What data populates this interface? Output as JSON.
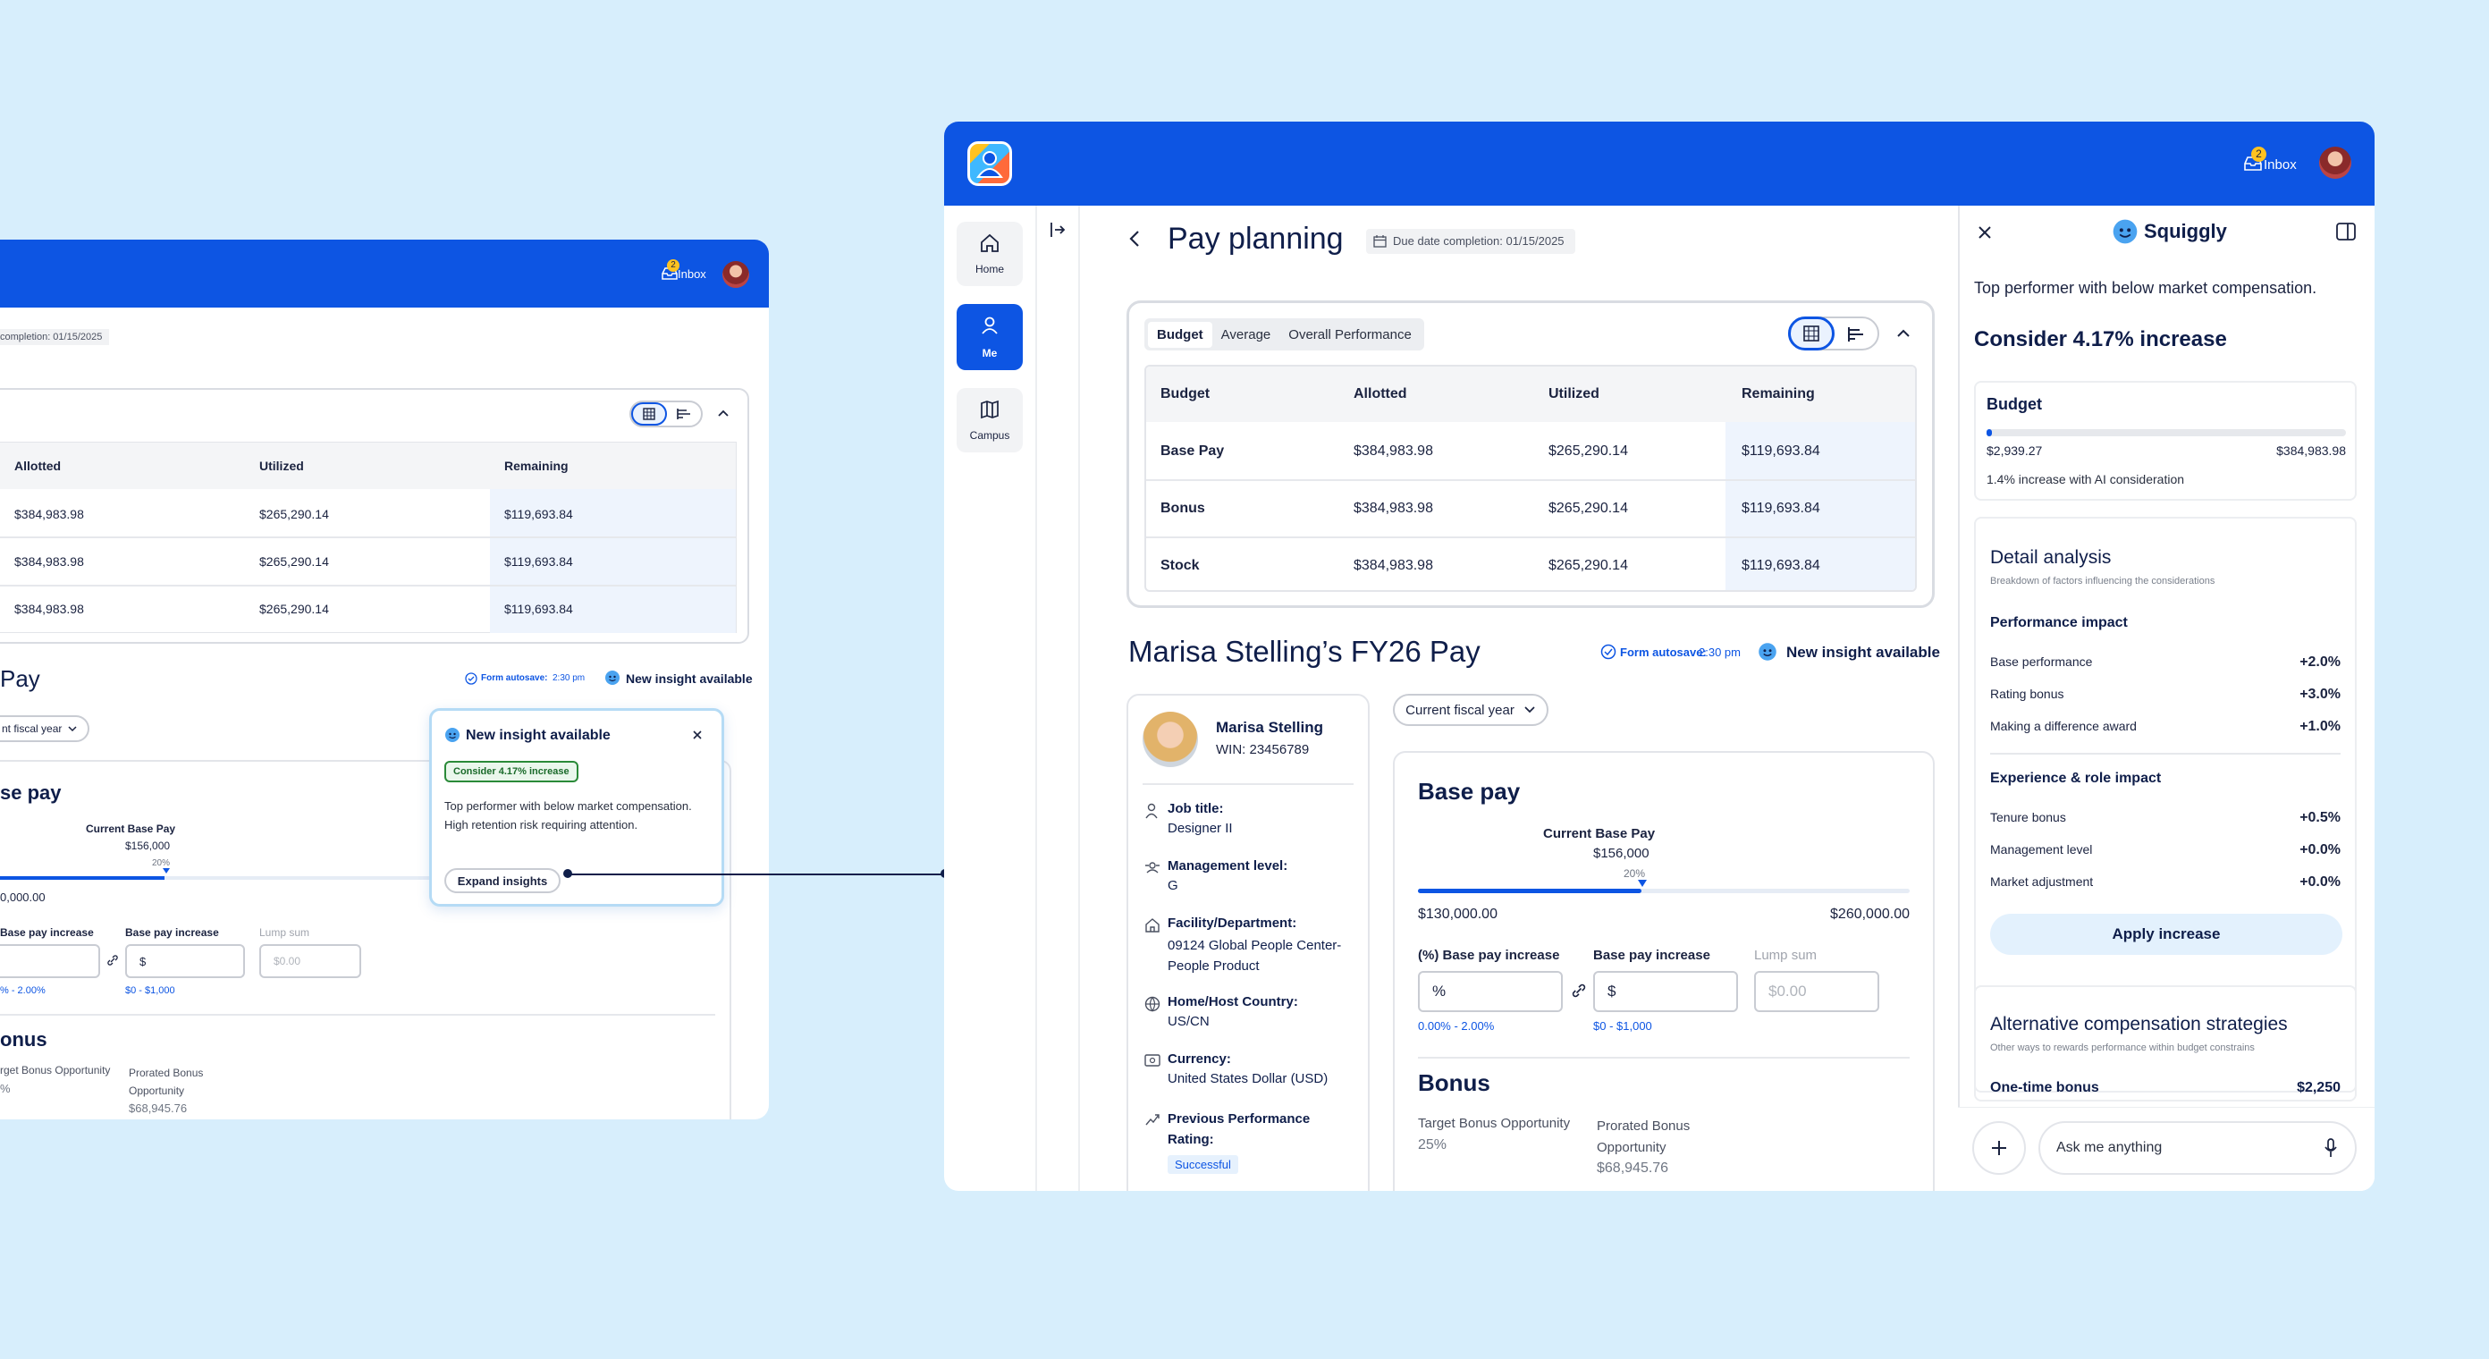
{
  "colors": {
    "brand_blue": "#0d55e3",
    "background": "#d7eefc",
    "navy": "#0f1e4a",
    "success_green": "#1a7a2a",
    "accent_light": "#e6f1fd"
  },
  "header": {
    "inbox_label": "Inbox",
    "inbox_badge": "2"
  },
  "nav": {
    "home": "Home",
    "me": "Me",
    "campus": "Campus"
  },
  "page": {
    "title": "Pay planning",
    "due_date": "Due date completion: 01/15/2025",
    "due_date_cropped": "completion: 01/15/2025"
  },
  "budget": {
    "tabs": [
      "Budget",
      "Average",
      "Overall Performance"
    ],
    "headers": [
      "Budget",
      "Allotted",
      "Utilized",
      "Remaining"
    ],
    "rows": [
      {
        "name": "Base Pay",
        "allotted": "$384,983.98",
        "utilized": "$265,290.14",
        "remaining": "$119,693.84"
      },
      {
        "name": "Bonus",
        "allotted": "$384,983.98",
        "utilized": "$265,290.14",
        "remaining": "$119,693.84"
      },
      {
        "name": "Stock",
        "allotted": "$384,983.98",
        "utilized": "$265,290.14",
        "remaining": "$119,693.84"
      }
    ]
  },
  "employee": {
    "section_title": "Marisa Stelling’s FY26 Pay",
    "section_title_cropped": "Pay",
    "autosave_label": "Form autosave:",
    "autosave_time": "2:30 pm",
    "insight_label": "New insight available",
    "name": "Marisa Stelling",
    "win": "WIN: 23456789",
    "fiscal_select": "Current fiscal year",
    "fiscal_select_cropped": "nt fiscal year",
    "details": [
      {
        "label": "Job title:",
        "value": "Designer II"
      },
      {
        "label": "Management level:",
        "value": "G"
      },
      {
        "label": "Facility/Department:",
        "value": "09124 Global People Center-People Product"
      },
      {
        "label": "Home/Host Country:",
        "value": "US/CN"
      },
      {
        "label": "Currency:",
        "value": "United States Dollar (USD)"
      },
      {
        "label": "Previous Performance Rating:",
        "value": "Successful"
      }
    ]
  },
  "base_pay": {
    "title": "Base pay",
    "title_cropped": "se pay",
    "current_label": "Current Base Pay",
    "current_value": "$156,000",
    "percent": "20%",
    "range_fraction": 0.2,
    "min": "$130,000.00",
    "min_cropped": "0,000.00",
    "max": "$260,000.00",
    "pct_increase_label": "(%) Base pay increase",
    "pct_increase_label_cropped": "Base pay increase",
    "pct_placeholder": "%",
    "pct_hint": "0.00% - 2.00%",
    "pct_hint_cropped": "% - 2.00%",
    "amt_increase_label": "Base pay increase",
    "amt_placeholder": "$",
    "amt_hint": "$0 - $1,000",
    "lump_label": "Lump sum",
    "lump_placeholder": "$0.00"
  },
  "bonus": {
    "title": "Bonus",
    "title_cropped": "onus",
    "target_label": "Target Bonus Opportunity",
    "target_label_cropped": "rget Bonus Opportunity",
    "target_value": "25%",
    "target_value_cropped": "%",
    "prorated_label": "Prorated Bonus Opportunity",
    "prorated_value": "$68,945.76"
  },
  "popover": {
    "title": "New insight available",
    "chip": "Consider 4.17% increase",
    "body": "Top performer with below market compensation. High retention risk requiring attention.",
    "button": "Expand insights"
  },
  "squiggly": {
    "title": "Squiggly",
    "intro": "Top performer with below market compensation.",
    "headline": "Consider 4.17% increase",
    "budget_title": "Budget",
    "budget_min": "$2,939.27",
    "budget_max": "$384,983.98",
    "budget_fraction": 0.014,
    "budget_note": "1.4% increase with AI consideration",
    "detail_title": "Detail analysis",
    "detail_sub": "Breakdown of factors influencing the considerations",
    "perf_title": "Performance impact",
    "perf": [
      {
        "label": "Base performance",
        "value": "+2.0%"
      },
      {
        "label": "Rating bonus",
        "value": "+3.0%"
      },
      {
        "label": "Making a difference award",
        "value": "+1.0%"
      }
    ],
    "exp_title": "Experience & role impact",
    "exp": [
      {
        "label": "Tenure bonus",
        "value": "+0.5%"
      },
      {
        "label": "Management level",
        "value": "+0.0%"
      },
      {
        "label": "Market adjustment",
        "value": "+0.0%"
      }
    ],
    "apply_button": "Apply increase",
    "alt_title": "Alternative compensation strategies",
    "alt_sub": "Other ways to rewards performance within budget constrains",
    "alt_item_label": "One-time bonus",
    "alt_item_value": "$2,250",
    "chat_placeholder": "Ask me anything"
  }
}
